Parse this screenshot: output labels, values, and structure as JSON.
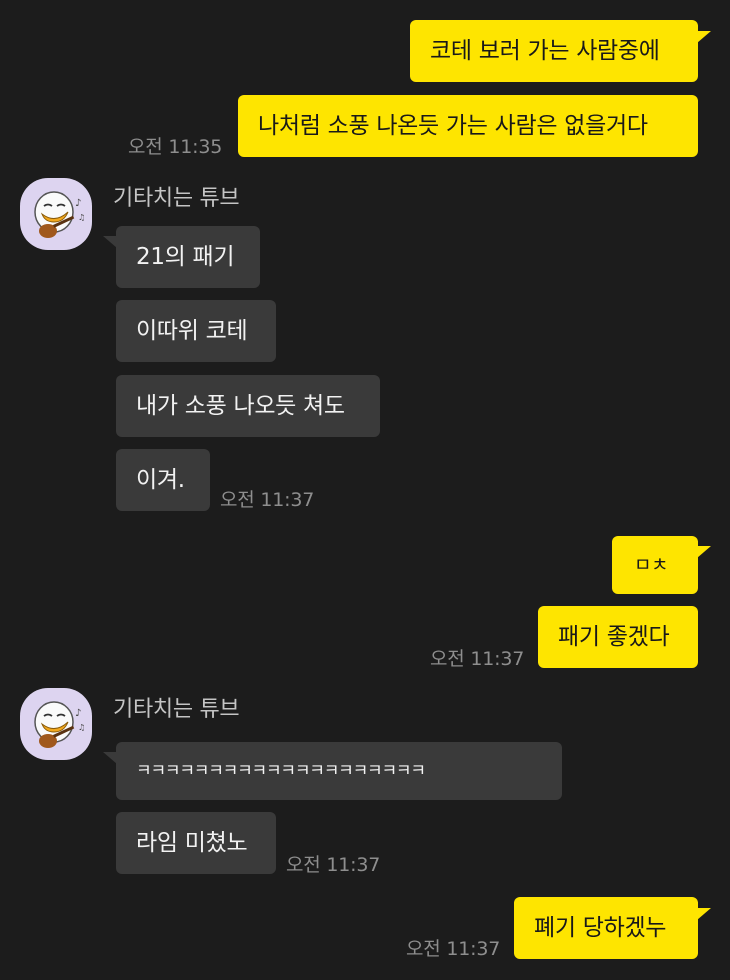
{
  "chat": {
    "sender_name": "기타치는 튜브",
    "messages": [
      {
        "from": "me",
        "text": "코테 보러 가는 사람중에"
      },
      {
        "from": "me",
        "text": "나처럼 소풍 나온듯 가는 사람은 없을거다",
        "time": "오전 11:35"
      },
      {
        "from": "them",
        "text": "21의 패기"
      },
      {
        "from": "them",
        "text": "이따위 코테"
      },
      {
        "from": "them",
        "text": "내가 소풍 나오듯 쳐도"
      },
      {
        "from": "them",
        "text": "이겨.",
        "time": "오전 11:37"
      },
      {
        "from": "me",
        "text": "ㅁㅊ"
      },
      {
        "from": "me",
        "text": "패기 좋겠다",
        "time": "오전 11:37"
      },
      {
        "from": "them",
        "text": "ㅋㅋㅋㅋㅋㅋㅋㅋㅋㅋㅋㅋㅋㅋㅋㅋㅋㅋㅋㅋ"
      },
      {
        "from": "them",
        "text": "라임 미쳤노",
        "time": "오전 11:37"
      },
      {
        "from": "me",
        "text": "폐기 당하겠누",
        "time": "오전 11:37"
      }
    ]
  },
  "colors": {
    "background": "#1c1c1c",
    "my_bubble": "#fee500",
    "their_bubble": "#3a3a3a",
    "timestamp": "#8e8e8e",
    "avatar_bg": "#ddd4f0"
  },
  "icons": {
    "avatar": "tube-character-playing-guitar"
  }
}
